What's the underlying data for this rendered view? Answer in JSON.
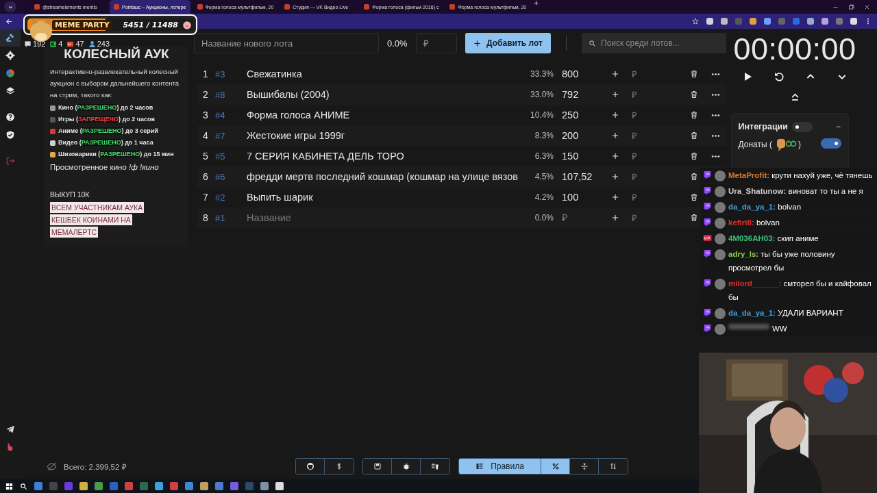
{
  "browser": {
    "tabs": [
      {
        "title": "@streamelements mentio",
        "selected": false
      },
      {
        "title": "Pointauc – Аукционы, лотере",
        "selected": true
      },
      {
        "title": "Форма голоса мультфильм, 20",
        "selected": false
      },
      {
        "title": "Студия — VK Видео Live",
        "selected": false
      },
      {
        "title": "Форма голоса (фильм 2016) с",
        "selected": false
      },
      {
        "title": "Форма голоса мультфильм, 20",
        "selected": false
      }
    ]
  },
  "overlay_widget": {
    "title": "MEME PARTY",
    "progress": "5451 / 11488",
    "level": 0.47
  },
  "sidebar": {
    "items": [
      {
        "selected": true
      },
      {
        "selected": false
      },
      {
        "selected": false
      },
      {
        "selected": false
      },
      {
        "selected": false
      },
      {
        "selected": false
      },
      {
        "selected": false
      }
    ]
  },
  "stats": [
    {
      "value": "192"
    },
    {
      "value": "4"
    },
    {
      "value": "47"
    },
    {
      "value": "243"
    }
  ],
  "info": {
    "title": "КОЛЕСНЫЙ АУК",
    "description": "Интерактивно-развлекательный колесный аукцион с выбором дальнейшего контента на стрим, такого как:",
    "rules": [
      {
        "before": "Кино (",
        "status": "РАЗРЕШЕНО",
        "allowed": true,
        "after": ") до 2 часов"
      },
      {
        "before": "Игры (",
        "status": "ЗАПРЕЩЕНО",
        "allowed": false,
        "after": ") до 2 часов"
      },
      {
        "before": "Аниме (",
        "status": "РАЗРЕШЕНО",
        "allowed": true,
        "after": ") до 3 серий"
      },
      {
        "before": "Видео (",
        "status": "РАЗРЕШЕНО",
        "allowed": true,
        "after": ") до 1 часа"
      },
      {
        "before": "Шизоварики (",
        "status": "РАЗРЕШЕНО",
        "allowed": true,
        "after": ") до 15 мин"
      }
    ],
    "watched": "Просмотренное кино *!ф !кино*",
    "buyout": "ВЫКУП 10К",
    "highlights": [
      "ВСЕМ УЧАСТНИКАМ АУКА",
      "КЕШБЕК КОИНАМИ НА",
      "МЕМАЛЕРТС"
    ]
  },
  "new_lot": {
    "name_placeholder": "Название нового лота",
    "share": "0.0%",
    "amount_placeholder": "₽",
    "add_button": "Добавить лот",
    "search_placeholder": "Поиск среди лотов..."
  },
  "lots": [
    {
      "rank": "1",
      "id": "#3",
      "name": "Свежатинка",
      "share": "33.3%",
      "amount": "800",
      "add_placeholder": "₽",
      "has_menu": true
    },
    {
      "rank": "2",
      "id": "#8",
      "name": "Вышибалы (2004)",
      "share": "33.0%",
      "amount": "792",
      "add_placeholder": "₽",
      "has_menu": true
    },
    {
      "rank": "3",
      "id": "#4",
      "name": "Форма голоса АНИМЕ",
      "share": "10.4%",
      "amount": "250",
      "add_placeholder": "₽",
      "has_menu": true
    },
    {
      "rank": "4",
      "id": "#7",
      "name": "Жестокие игры 1999г",
      "share": "8.3%",
      "amount": "200",
      "add_placeholder": "₽",
      "has_menu": true
    },
    {
      "rank": "5",
      "id": "#5",
      "name": "7 СЕРИЯ КАБИНЕТА ДЕЛЬ ТОРО",
      "share": "6.3%",
      "amount": "150",
      "add_placeholder": "₽",
      "has_menu": true
    },
    {
      "rank": "6",
      "id": "#6",
      "name": "фредди мертв последний кошмар (кошмар на улице вязов",
      "share": "4.5%",
      "amount": "107,52",
      "add_placeholder": "₽",
      "has_menu": false
    },
    {
      "rank": "7",
      "id": "#2",
      "name": "Выпить шарик",
      "share": "4.2%",
      "amount": "100",
      "add_placeholder": "₽",
      "has_menu": false
    },
    {
      "rank": "8",
      "id": "#1",
      "name_placeholder": "Название",
      "share": "0.0%",
      "amount_placeholder": "₽",
      "add_placeholder": "₽",
      "has_menu": false
    }
  ],
  "timer": {
    "time": "00:00:00"
  },
  "integrations": {
    "title": "Интеграции",
    "on": false,
    "donations_label": "Донаты (",
    "donations_label_end": ")",
    "donations_on": true
  },
  "chat": [
    {
      "kind": "twitch",
      "user": "MetaProfit:",
      "color": "#e0782a",
      "text": "крути нахуй уже, чё тянешь"
    },
    {
      "kind": "twitch",
      "user": "Ura_Shatunow:",
      "color": "#d0d0d0",
      "text": "виноват то ты а не я"
    },
    {
      "kind": "twitch",
      "user": "da_da_ya_1:",
      "color": "#3aa0e0",
      "text": "bolvan"
    },
    {
      "kind": "twitch",
      "user": "kefirill:",
      "color": "#e03030",
      "text": "bolvan"
    },
    {
      "kind": "live",
      "user": "4M036AH03:",
      "color": "#40c080",
      "text": "скип аниме"
    },
    {
      "kind": "twitch",
      "user": "adry_ls:",
      "color": "#8bd04a",
      "text": "ты бы уже половину просмотрел бы"
    },
    {
      "kind": "twitch",
      "user": "milord______:",
      "color": "#e02a2a",
      "text": "смторел бы и кайфовал бы"
    },
    {
      "kind": "twitch",
      "user": "da_da_ya_1:",
      "color": "#3aa0e0",
      "text": "УДАЛИ ВАРИАНТ"
    },
    {
      "kind": "twitch",
      "text": "WW"
    }
  ],
  "footer": {
    "total": "Всего: 2.399,52 ₽",
    "groups": [
      {
        "buttons": [
          {
            "selected": false
          },
          {
            "selected": false
          }
        ]
      },
      {
        "buttons": [
          {
            "selected": false
          },
          {
            "selected": false
          },
          {
            "selected": false
          }
        ]
      },
      {
        "buttons": [
          {
            "label": "Правила",
            "selected": true
          },
          {
            "selected": true
          },
          {
            "selected": false
          },
          {
            "selected": false
          }
        ]
      }
    ]
  }
}
